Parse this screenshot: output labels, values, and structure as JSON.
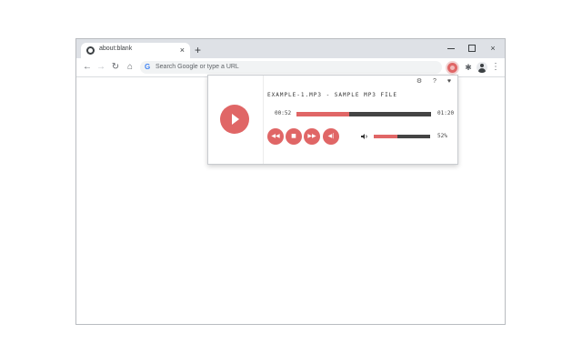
{
  "browser": {
    "tab_title": "about:blank",
    "tab_close": "×",
    "new_tab": "+",
    "window_close": "×",
    "omnibox_g": "G",
    "omnibox_placeholder": "Search Google or type a URL",
    "nav_back": "←",
    "nav_forward": "→",
    "nav_reload": "↻",
    "nav_home": "⌂",
    "menu": "⋮",
    "extensions": "✱"
  },
  "player": {
    "track_title": "EXAMPLE-1.MP3 - SAMPLE MP3 FILE",
    "current_time": "00:52",
    "duration": "01:20",
    "progress_fraction": 0.39,
    "volume_fraction": 0.42,
    "volume_label": "52%",
    "top_icons": [
      "⚙",
      "?",
      "♥"
    ],
    "controls": {
      "rewind": "◀◀",
      "stop": "■",
      "fast_forward": "▶▶",
      "previous": "◀|"
    },
    "accent_color": "#e06666",
    "track_color": "#444444"
  }
}
